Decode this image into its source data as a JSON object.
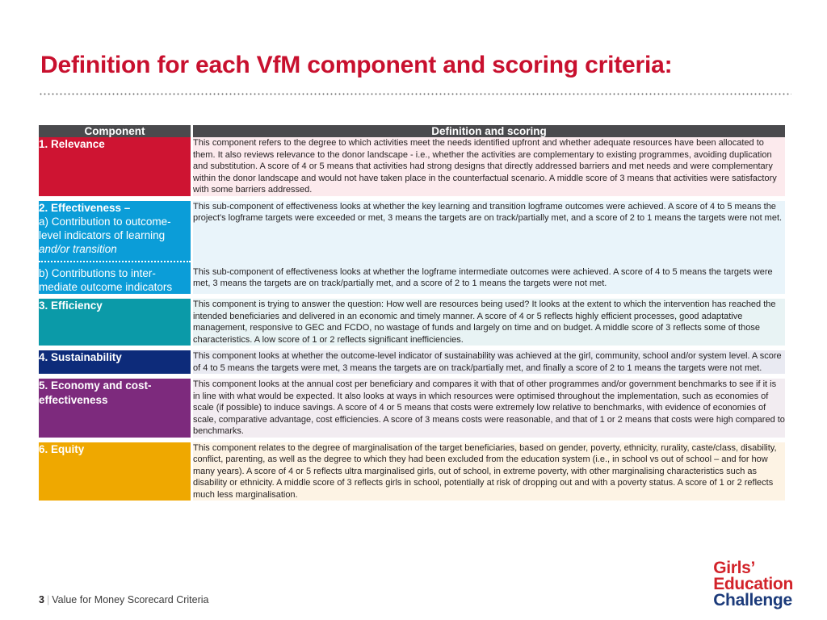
{
  "slide": {
    "title": "Definition for each VfM component and scoring criteria:",
    "title_color": "#c8102e"
  },
  "table": {
    "headers": {
      "component": "Component",
      "definition": "Definition and scoring"
    },
    "rows": [
      {
        "label": "1. Relevance",
        "color": "#ce1432",
        "tint": "#fceaed",
        "definition": "This component refers to the degree to which activities meet the needs identified upfront and whether adequate resources have been allocated to them. It also reviews relevance to the donor landscape - i.e., whether the activities are complementary to existing programmes, avoiding duplication and substitution.  A score of 4 or 5 means that activities had strong designs that directly addressed barriers and met needs and were complementary within the donor landscape and would not have taken place in the counterfactual scenario. A middle score of 3 means that activities were satisfactory with some barriers addressed."
      },
      {
        "label": "2. Effectiveness –",
        "color": "#0b9dd8",
        "tint": "#e9f4fa",
        "sub_a_line1": "a) Contribution to outcome-",
        "sub_a_line2": "level indicators of learning",
        "sub_a_italic": "and/or transition",
        "sub_b_line1": "b) Contributions to inter-",
        "sub_b_line2": "mediate outcome indicators",
        "definition_a": "This sub-component of effectiveness looks at whether the key learning and transition logframe outcomes were achieved. A score of 4 to 5 means the project's logframe targets were exceeded or met, 3 means the targets are on track/partially met, and a score of 2 to 1 means the targets were not met.",
        "definition_b": "This sub-component of effectiveness looks at whether the logframe intermediate outcomes were achieved. A score of 4 to 5 means the targets were met, 3 means the targets are on track/partially met, and a score of 2 to 1 means the targets were not met."
      },
      {
        "label": "3. Efficiency",
        "color": "#0b9aa8",
        "tint": "#e8f3f4",
        "definition": "This component is trying to answer the question: How well are resources being used? It looks at the extent to which the intervention has reached the intended beneficiaries and delivered in an economic and timely manner. A score of 4 or 5 reflects highly efficient processes, good adaptative management, responsive to GEC and FCDO, no wastage of funds and largely on time and on budget. A middle score of 3 reflects some of those characteristics. A low score of 1 or 2 reflects significant inefficiencies."
      },
      {
        "label": "4. Sustainability",
        "color": "#0d2b7a",
        "tint": "#e9eaf2",
        "definition": "This component looks at whether the outcome-level indicator of sustainability was achieved at the girl, community, school and/or system level. A score of 4 to 5 means the targets were met, 3 means the targets are on track/partially met, and finally a score of 2 to 1 means the targets were not met."
      },
      {
        "label": "5. Economy and cost-effectiveness",
        "color": "#7d2a7d",
        "tint": "#f2ecf1",
        "definition": "This component looks at the annual cost per beneficiary and compares it with that of other programmes and/or government benchmarks to see if it is in line with what would be expected. It also looks at ways in which resources were optimised throughout the implementation, such as economies of scale (if possible) to induce savings. A score of 4 or 5 means that costs were extremely low relative to benchmarks, with evidence of economies of scale, comparative advantage, cost efficiencies. A score of 3 means costs were reasonable, and that of 1 or 2 means that costs were high compared to benchmarks."
      },
      {
        "label": "6. Equity",
        "color": "#efa800",
        "tint": "#fdf3e4",
        "definition": "This component relates to the degree of marginalisation of the target beneficiaries, based on gender, poverty, ethnicity, rurality, caste/class, disability, conflict, parenting, as well as the degree to which they had been excluded from the education system (i.e., in school vs out of school – and for how many years). A score of 4 or 5 reflects ultra marginalised girls, out of school, in extreme poverty, with other marginalising characteristics such as disability or ethnicity. A middle score of 3 reflects girls in school, potentially at risk of dropping out and with a poverty status. A score of 1 or 2 reflects much less marginalisation."
      }
    ]
  },
  "footer": {
    "page_number": "3",
    "separator": "|",
    "text": "Value for Money Scorecard Criteria"
  },
  "logo": {
    "line1": "Girls’",
    "line2": "Education",
    "line3": "Challenge",
    "red": "#d2232a",
    "navy": "#1b3a7a"
  }
}
